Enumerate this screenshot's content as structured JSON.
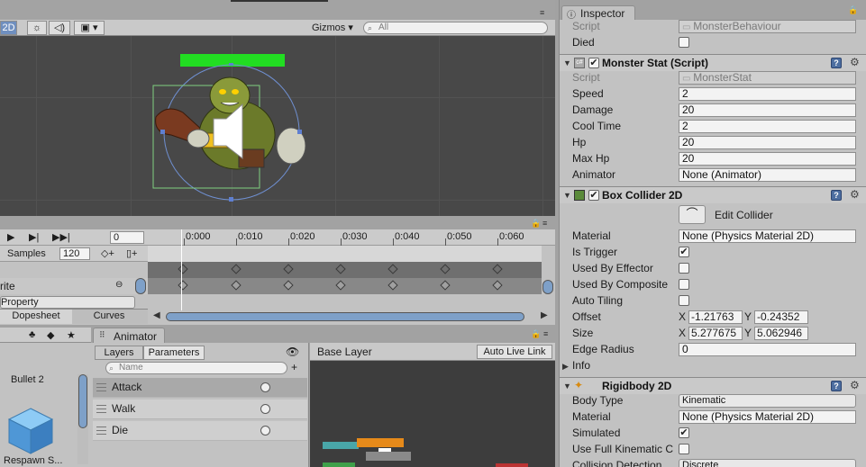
{
  "scene": {
    "mode_2d": "2D",
    "gizmos_label": "Gizmos",
    "search_placeholder": "All"
  },
  "animation": {
    "frame_value": "0",
    "samples_label": "Samples",
    "samples_value": "120",
    "ticks": [
      "0:000",
      "0:010",
      "0:020",
      "0:030",
      "0:040",
      "0:050",
      "0:060"
    ],
    "property_label": "rite",
    "property_partial": "Property",
    "dopesheet_tab": "Dopesheet",
    "curves_tab": "Curves"
  },
  "project": {
    "asset_name": "Bullet 2",
    "asset_bottom": "Respawn S..."
  },
  "animator": {
    "tab_label": "Animator",
    "layers_tab": "Layers",
    "parameters_tab": "Parameters",
    "name_placeholder": "Name",
    "base_layer": "Base Layer",
    "auto_live_link": "Auto Live Link",
    "params": [
      "Attack",
      "Walk",
      "Die"
    ]
  },
  "inspector": {
    "tab_label": "Inspector",
    "script_top_label": "Script",
    "script_top_value": "MonsterBehaviour",
    "died_label": "Died",
    "monster_stat": {
      "title": "Monster Stat (Script)",
      "fields": [
        {
          "label": "Script",
          "value": "MonsterStat"
        },
        {
          "label": "Speed",
          "value": "2"
        },
        {
          "label": "Damage",
          "value": "20"
        },
        {
          "label": "Cool Time",
          "value": "2"
        },
        {
          "label": "Hp",
          "value": "20"
        },
        {
          "label": "Max Hp",
          "value": "20"
        },
        {
          "label": "Animator",
          "value": "None (Animator)"
        }
      ]
    },
    "box_collider": {
      "title": "Box Collider 2D",
      "edit_collider": "Edit Collider",
      "material_label": "Material",
      "material_value": "None (Physics Material 2D)",
      "is_trigger": "Is Trigger",
      "used_by_effector": "Used By Effector",
      "used_by_composite": "Used By Composite",
      "auto_tiling": "Auto Tiling",
      "offset_label": "Offset",
      "offset_x": "-1.21763",
      "offset_y": "-0.24352",
      "size_label": "Size",
      "size_x": "5.277675",
      "size_y": "5.062946",
      "edge_radius_label": "Edge Radius",
      "edge_radius_value": "0",
      "info_label": "Info",
      "x_label": "X",
      "y_label": "Y"
    },
    "rigidbody": {
      "title": "Rigidbody 2D",
      "body_type_label": "Body Type",
      "body_type_value": "Kinematic",
      "material_label": "Material",
      "material_value": "None (Physics Material 2D)",
      "simulated_label": "Simulated",
      "full_kinematic_label": "Use Full Kinematic C",
      "collision_label": "Collision Detection",
      "collision_value": "Discrete"
    }
  },
  "colors": {
    "health_bar": "#22dd22",
    "scene_bg": "#484848",
    "selection_blue": "#6f8fbf"
  }
}
